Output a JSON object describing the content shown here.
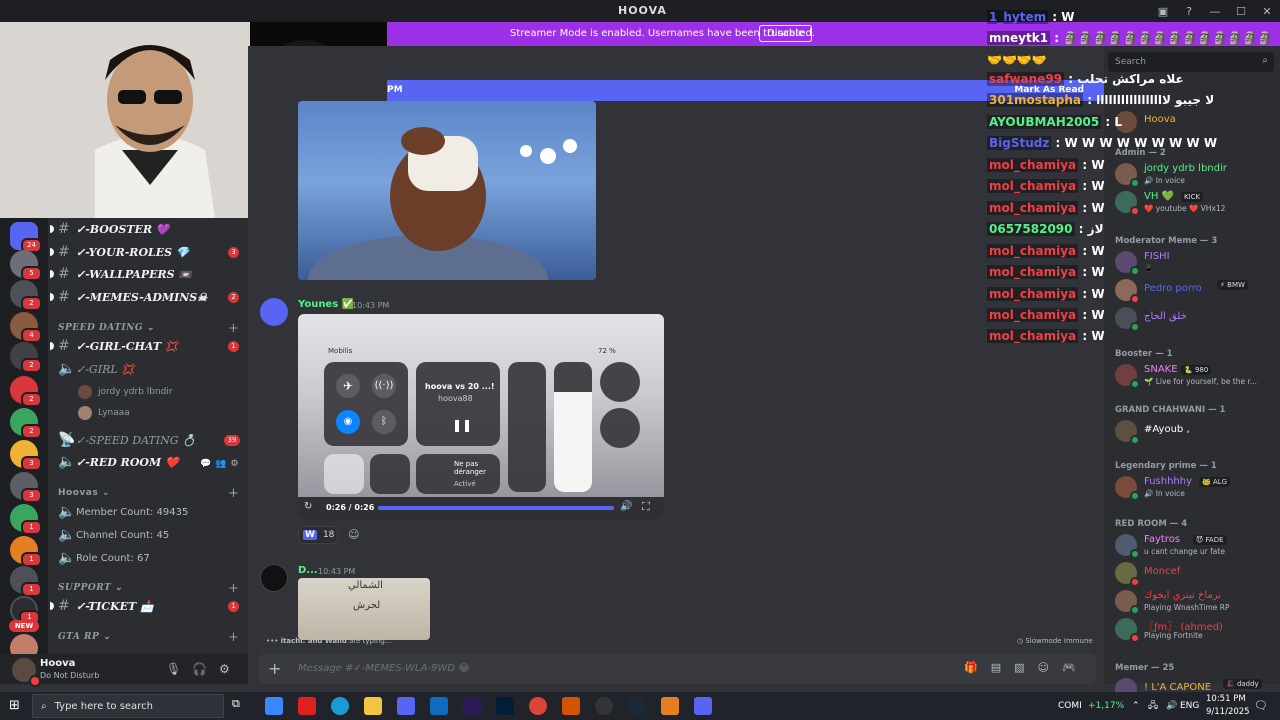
{
  "window": {
    "title": "HOOVA"
  },
  "banner": {
    "text": "Streamer Mode is enabled. Usernames have been truncated.",
    "button": "Disable"
  },
  "new_messages": {
    "time_fragment": "PM",
    "mark_read": "Mark As Read"
  },
  "rail": {
    "badges": [
      "24",
      "5",
      "2",
      "4",
      "2",
      "2",
      "2",
      "3",
      "3",
      "1",
      "1",
      "1",
      "1",
      "1"
    ],
    "new_label": "NEW"
  },
  "channels": {
    "booster": "✓-BOOSTER 💜",
    "your_roles": "✓-YOUR-ROLES 💎",
    "your_roles_count": "3",
    "wallpapers": "✓-WALLPAPERS 📼",
    "memes_admins": "✓-MEMES-ADMINS☠",
    "memes_admins_count": "2",
    "cat_speed_dating": "SPEED DATING ⌄",
    "girl_chat": "✓-GIRL-CHAT 💢",
    "girl_chat_count": "1",
    "girl_voice": "✓-GIRL 💢",
    "girl_members": [
      "jordy ydrb lbndir",
      "Lynaaa"
    ],
    "speed_dating_voice": "✓-SPEED DATING 💍",
    "speed_dating_count": "39",
    "red_room": "✓-RED ROOM ❤️",
    "cat_hoovas": "Hoovas ⌄",
    "member_count": "Member Count: 49435",
    "channel_count": "Channel Count: 45",
    "role_count": "Role Count: 67",
    "cat_support": "SUPPORT ⌄",
    "ticket": "✓-TICKET 📩",
    "ticket_count": "1",
    "cat_gta": "GTA RP ⌄"
  },
  "user": {
    "name": "Hoova",
    "status": "Do Not Disturb"
  },
  "messages": [
    {
      "author": "Younes ✅",
      "time": "10:43 PM",
      "author_color": "#57f287"
    },
    {
      "author": "D...",
      "time": "10:43 PM",
      "author_color": "#57f287"
    }
  ],
  "video2": {
    "carrier": "Mobilis",
    "battery": "72 %",
    "media_title": "hoova vs 20 ...!",
    "media_sub": "hoova88",
    "dnd_title": "Ne pas déranger",
    "dnd_sub": "Activé",
    "time": "0:26 / 0:26",
    "progress": 1.0
  },
  "reaction": {
    "emoji": "W",
    "count": "18"
  },
  "image_text": [
    "الشمالي",
    "لحرش"
  ],
  "typing": {
    "names": "itachi. and Walid",
    "suffix": " are typing..."
  },
  "slowmode": "Slowmode Immune",
  "input": {
    "placeholder": "Message #✓-MEMES-WLA-9WD 😂"
  },
  "search": {
    "placeholder": "Search"
  },
  "member_list": {
    "top": {
      "name": "Hoova",
      "color": "#f0b232"
    },
    "groups": [
      {
        "label": "Admin — 2",
        "members": [
          {
            "name": "jordy ydrb lbndir",
            "sub": "🔊 In voice",
            "color": "#57f287"
          },
          {
            "name": "VH 💚",
            "tag": "KICK",
            "sub": "❤️ youtube ❤️ VHx12",
            "color": "#57f287"
          }
        ]
      },
      {
        "label": "Moderator Meme — 3",
        "members": [
          {
            "name": "FISHI",
            "sub": "📱",
            "color": "#b57aff"
          },
          {
            "name": "Pedro porro",
            "tag": "⚡ BMW",
            "sub": "",
            "color": "#5865f2"
          },
          {
            "name": "خلق الحاج",
            "sub": "",
            "color": "#b57aff"
          }
        ]
      },
      {
        "label": "Booster — 1",
        "members": [
          {
            "name": "SNAKE",
            "tag": "🐍 980",
            "sub": "🌱 Live for yourself, be the r...",
            "color": "#f47fff"
          }
        ]
      },
      {
        "label": "GRAND CHAHWANI — 1",
        "members": [
          {
            "name": "#Ayoub ,",
            "sub": "",
            "color": "#ffffff"
          }
        ]
      },
      {
        "label": "Legendary prime — 1",
        "members": [
          {
            "name": "Fushhhhy",
            "tag": "🐸 ALG",
            "sub": "🔊 In voice",
            "color": "#b57aff"
          }
        ]
      },
      {
        "label": "RED ROOM — 4",
        "members": [
          {
            "name": "Faytros",
            "tag": "😈 FADE",
            "sub": "u cant change ur fate",
            "color": "#f47fff"
          },
          {
            "name": "Moncef",
            "sub": "",
            "color": "#f23f43"
          },
          {
            "name": "نرماخ تيتري ايخوك",
            "sub": "Playing WnashTime RP",
            "color": "#f23f43"
          },
          {
            "name": "〖ƒm〗 (ahmed)",
            "sub": "Playing Fortnite",
            "color": "#f23f43"
          }
        ]
      },
      {
        "label": "Memer — 25",
        "members": [
          {
            "name": "! L'A CAPONE",
            "tag": "🎩 daddy",
            "sub": "",
            "color": "#f0b232"
          }
        ]
      }
    ]
  },
  "overlay_chat": [
    {
      "user": "1_hytem",
      "msg": "W",
      "color": "#5865f2"
    },
    {
      "user": "mneytk1",
      "msg": "🗿🗿🗿🗿🗿🗿🗿🗿🗿🗿🗿🗿🗿🗿",
      "color": "#ffffff"
    },
    {
      "user": "",
      "msg": "🤝🤝🤝🤝",
      "color": "#ffffff"
    },
    {
      "user": "safwane99",
      "msg": "علاه مراكش تحلب",
      "color": "#f23f43"
    },
    {
      "user": "301mostapha",
      "msg": "لا جيبو لااااااااااااااااا",
      "color": "#f0b232"
    },
    {
      "user": "AYOUBMAH2005",
      "msg": "L",
      "color": "#57f287"
    },
    {
      "user": "BigStudz",
      "msg": "W W W W W W W W W",
      "color": "#5865f2"
    },
    {
      "user": "mol_chamiya",
      "msg": "W",
      "color": "#f23f43"
    },
    {
      "user": "mol_chamiya",
      "msg": "W",
      "color": "#f23f43"
    },
    {
      "user": "mol_chamiya",
      "msg": "W",
      "color": "#f23f43"
    },
    {
      "user": "0657582090",
      "msg": "لاز",
      "color": "#57f287"
    },
    {
      "user": "mol_chamiya",
      "msg": "W",
      "color": "#f23f43"
    },
    {
      "user": "mol_chamiya",
      "msg": "W",
      "color": "#f23f43"
    },
    {
      "user": "mol_chamiya",
      "msg": "W",
      "color": "#f23f43"
    },
    {
      "user": "mol_chamiya",
      "msg": "W",
      "color": "#f23f43"
    },
    {
      "user": "mol_chamiya",
      "msg": "W",
      "color": "#f23f43"
    }
  ],
  "taskbar": {
    "search": "Type here to search",
    "stock_name": "COMI",
    "stock_change": "+1,17%",
    "lang": "ENG",
    "time": "10:51 PM",
    "date": "9/11/2025"
  }
}
